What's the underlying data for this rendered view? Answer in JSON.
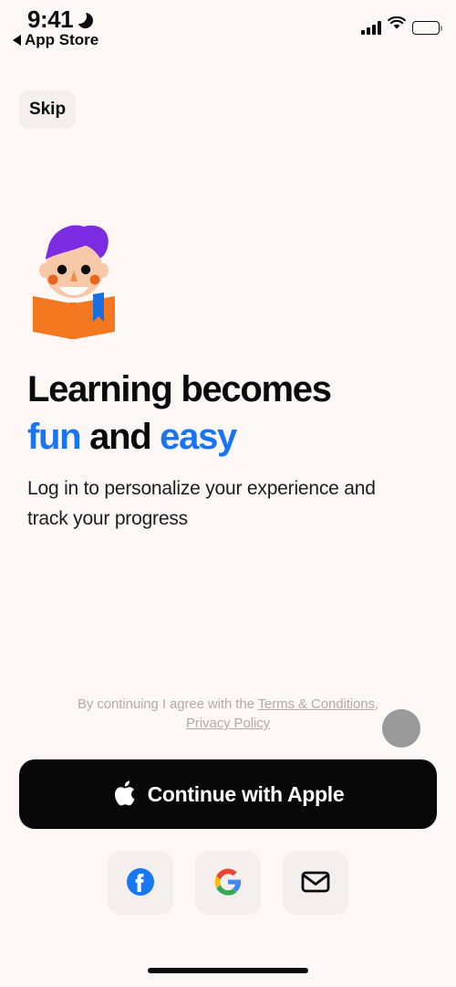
{
  "status_bar": {
    "time": "9:41",
    "dnd_icon": "moon-icon",
    "back_label": "App Store",
    "back_icon": "back-triangle-icon",
    "signal_icon": "cellular-signal-icon",
    "wifi_icon": "wifi-icon",
    "battery_icon": "battery-full-icon"
  },
  "nav": {
    "skip_label": "Skip"
  },
  "illustration": {
    "name": "child-reading-book-illustration",
    "colors": {
      "hair": "#7B2BE0",
      "skin": "#F7C9A8",
      "cheek": "#E8641E",
      "book": "#F4781F",
      "bookmark": "#1A6FE0",
      "eye": "#0B0B0B",
      "smile": "#FFFFFF"
    }
  },
  "headline": {
    "line1": "Learning becomes",
    "line2_word1": "fun",
    "line2_word2": "and",
    "line2_word3": "easy",
    "accent_color": "#1A73F0"
  },
  "subtitle": {
    "text": "Log in to personalize your experience and track your progress"
  },
  "legal": {
    "prefix": "By continuing I agree with the ",
    "terms_link": "Terms & Conditions",
    "separator": ", ",
    "privacy_link": "Privacy Policy"
  },
  "touch_indicator": {
    "color": "#9A9A9A"
  },
  "primary_button": {
    "label": "Continue with Apple",
    "icon": "apple-logo-icon",
    "background": "#080808",
    "text_color": "#FFFFFF"
  },
  "social_buttons": [
    {
      "name": "facebook",
      "icon": "facebook-icon",
      "color": "#1877F2"
    },
    {
      "name": "google",
      "icon": "google-icon",
      "color": "#4285F4"
    },
    {
      "name": "email",
      "icon": "envelope-icon",
      "color": "#0B0B0B"
    }
  ],
  "home_indicator": {
    "color": "#0B0B0B"
  }
}
